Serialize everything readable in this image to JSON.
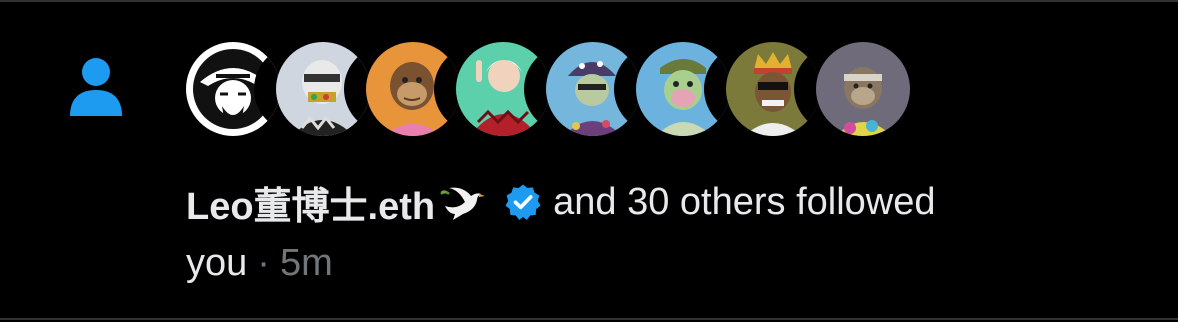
{
  "notification": {
    "type_icon": "person-icon",
    "avatars": [
      {
        "name": "pirate-logo-avatar"
      },
      {
        "name": "robot-ape-avatar"
      },
      {
        "name": "orange-ape-avatar"
      },
      {
        "name": "betty-white-avatar"
      },
      {
        "name": "mushroom-ape-avatar"
      },
      {
        "name": "zombie-ape-avatar"
      },
      {
        "name": "king-ape-avatar"
      },
      {
        "name": "tiedye-ape-avatar"
      }
    ],
    "actor_name": "Leo董博士.eth",
    "dove_icon": "dove-emoji-icon",
    "verified_icon": "verified-badge-icon",
    "message": "and 30 others followed",
    "message_cont": "you",
    "separator": "·",
    "time": "5m"
  },
  "colors": {
    "background": "#000000",
    "text": "#e7e9ea",
    "secondary": "#71767b",
    "accent": "#1d9bf0"
  }
}
